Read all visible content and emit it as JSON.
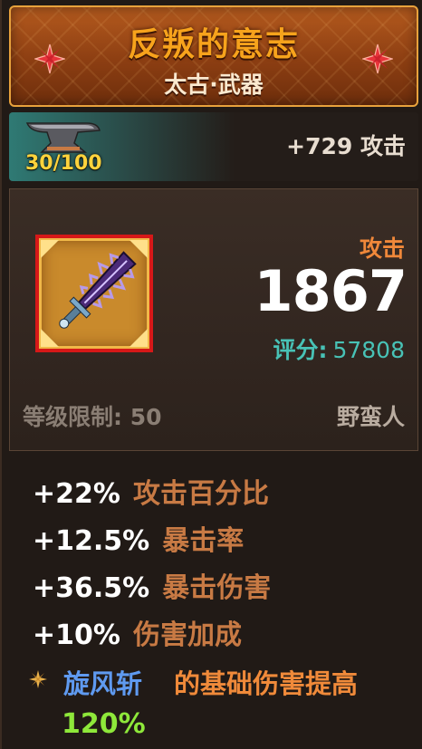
{
  "item": {
    "name": "反叛的意志",
    "category": "太古·武器",
    "name_color": "#f7a31c"
  },
  "forge": {
    "count": "30/100",
    "bonus": "+729 攻击",
    "icon": "anvil-icon"
  },
  "stats": {
    "attack_label": "攻击",
    "attack_value": "1867",
    "score_label": "评分:",
    "score_value": "57808",
    "level_requirement": "等级限制: 50",
    "class_requirement": "野蛮人"
  },
  "attributes": [
    {
      "value": "+22%",
      "name": "攻击百分比"
    },
    {
      "value": "+12.5%",
      "name": "暴击率"
    },
    {
      "value": "+36.5%",
      "name": "暴击伤害"
    },
    {
      "value": "+10%",
      "name": "伤害加成"
    }
  ],
  "skill_bonus": {
    "icon": "star-icon",
    "skill_name": "旋风斩",
    "description": "的基础伤害提高",
    "percent": "120%"
  },
  "colors": {
    "border_accent": "#e8a23c",
    "rarity_frame": "#d61818",
    "attack_label": "#f0883a",
    "score": "#48c2b6",
    "attribute_name": "#c87a44",
    "skill_name": "#5f9af0",
    "skill_percent": "#8ee83a"
  }
}
